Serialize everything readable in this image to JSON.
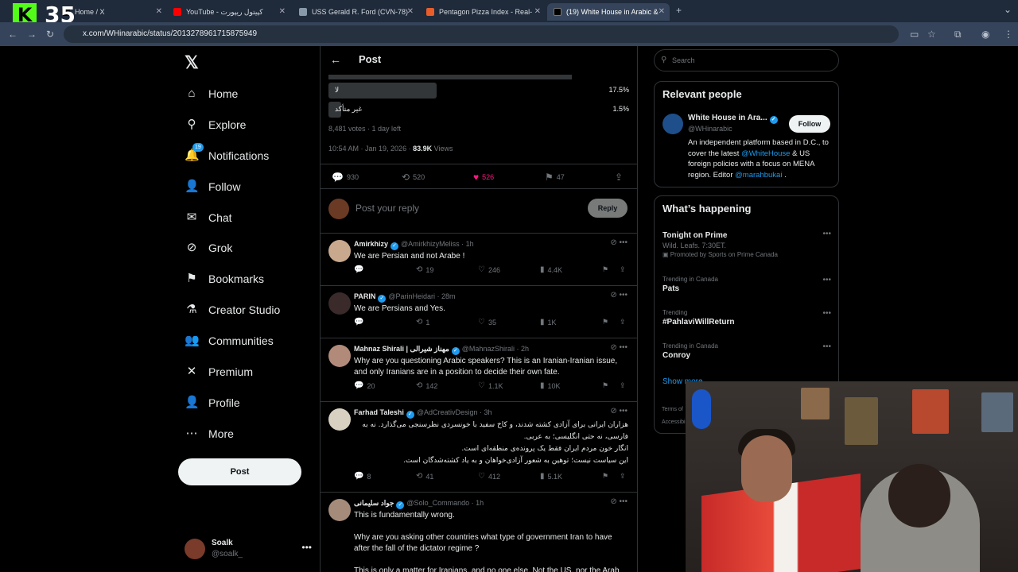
{
  "browser": {
    "tabs": [
      {
        "label": "Home / X",
        "fav": "#000000"
      },
      {
        "label": "YouTube - کپیتول ریپورت",
        "fav": "#ff0000"
      },
      {
        "label": "USS Gerald R. Ford (CVN-78)",
        "fav": "#8899aa"
      },
      {
        "label": "Pentagon Pizza Index - Real-",
        "fav": "#e85d2a"
      },
      {
        "label": "(19) White House in Arabic &",
        "fav": "#000000"
      }
    ],
    "url": "x.com/WHinarabic/status/2013278961715875949"
  },
  "stream": {
    "logo": "K",
    "count": "35"
  },
  "nav": {
    "items": [
      {
        "label": "Home",
        "icon": "home-icon",
        "glyph": "⌂"
      },
      {
        "label": "Explore",
        "icon": "search-icon",
        "glyph": "⚲"
      },
      {
        "label": "Notifications",
        "icon": "bell-icon",
        "glyph": "🔔"
      },
      {
        "label": "Follow",
        "icon": "person-add-icon",
        "glyph": "👤"
      },
      {
        "label": "Chat",
        "icon": "mail-icon",
        "glyph": "✉"
      },
      {
        "label": "Grok",
        "icon": "grok-icon",
        "glyph": "⊘"
      },
      {
        "label": "Bookmarks",
        "icon": "bookmark-icon",
        "glyph": "⚑"
      },
      {
        "label": "Creator Studio",
        "icon": "flask-icon",
        "glyph": "⚗"
      },
      {
        "label": "Communities",
        "icon": "people-icon",
        "glyph": "👥"
      },
      {
        "label": "Premium",
        "icon": "x-icon",
        "glyph": "✕"
      },
      {
        "label": "Profile",
        "icon": "profile-icon",
        "glyph": "👤"
      },
      {
        "label": "More",
        "icon": "more-circle-icon",
        "glyph": "⋯"
      }
    ],
    "notification_badge": "19",
    "post_button": "Post",
    "account": {
      "name": "Soalk",
      "handle": "@soalk_"
    }
  },
  "post": {
    "header": "Post",
    "poll": [
      {
        "label": "لا",
        "pct": "17.5%",
        "fraction": 0.175
      },
      {
        "label": "غير متأكد",
        "pct": "1.5%",
        "fraction": 0.015
      }
    ],
    "votes": "8,481 votes · 1 day left",
    "timestamp": "10:54 AM · Jan 19, 2026 · ",
    "views_count": "83.9K",
    "views_label": " Views",
    "stats": {
      "replies": "930",
      "reposts": "520",
      "likes": "526",
      "bookmarks": "47"
    },
    "reply_placeholder": "Post your reply",
    "reply_button": "Reply"
  },
  "replies": [
    {
      "name": "Amirkhizy",
      "handle": "@AmirkhizyMeliss · 1h",
      "text": "We are Persian and not Arabe !",
      "rtl": false,
      "reply": "",
      "repost": "19",
      "like": "246",
      "views": "4.4K",
      "avatar": "#c9a98e"
    },
    {
      "name": "PARIN",
      "handle": "@ParinHeidari · 28m",
      "text": "We are Persians and Yes.",
      "rtl": false,
      "reply": "",
      "repost": "1",
      "like": "35",
      "views": "1K",
      "avatar": "#3a2a2a"
    },
    {
      "name": "Mahnaz Shirali | مهناز شیرالی",
      "handle": "@MahnazShirali · 2h",
      "text": "Why are you questioning Arabic speakers? This is an Iranian-Iranian issue, and only Iranians are in a position to decide their own fate.",
      "rtl": false,
      "reply": "20",
      "repost": "142",
      "like": "1.1K",
      "views": "10K",
      "avatar": "#b28a7a"
    },
    {
      "name": "Farhad Taleshi",
      "handle": "@AdCreativDesign · 3h",
      "text": "هزاران ایرانی برای آزادی کشته شدند، و کاخ سفید با خونسردی نظرسنجی می‌گذارد. نه به فارسی، نه حتی انگلیسی؛ به عربی.\nانگار خون مردم ایران فقط یک پرونده‌ی منطقه‌ای است.\nاین سیاست نیست؛ توهین به شعور آزادی‌خواهان و به یاد کشته‌شدگان است.",
      "rtl": true,
      "reply": "8",
      "repost": "41",
      "like": "412",
      "views": "5.1K",
      "avatar": "#d8d0c0"
    },
    {
      "name": "جواد سلیمانی",
      "handle": "@Solo_Commando · 1h",
      "text": "This is fundamentally wrong.\n\nWhy are you asking other countries what type of government Iran to have after the fall of the dictator regime ?\n\nThis is only a matter for Iranians, and no one else. Not the US, nor the Arab",
      "rtl": false,
      "reply": "",
      "repost": "",
      "like": "",
      "views": "",
      "avatar": "#a58b7a"
    }
  ],
  "right": {
    "search_placeholder": "Search",
    "relevant_title": "Relevant people",
    "person": {
      "name": "White House in Ara...",
      "handle": "@WHinarabic",
      "follow": "Follow",
      "bio_1": "An independent platform based in D.C., to cover the latest ",
      "bio_link1": "@WhiteHouse",
      "bio_2": " & US foreign policies with a focus on MENA region. Editor ",
      "bio_link2": "@marahbukai",
      "bio_3": " ."
    },
    "happening_title": "What’s happening",
    "trends": [
      {
        "ctx": "",
        "title": "Tonight on Prime",
        "sub": "Wild. Leafs. 7:30ET.",
        "promo": "Promoted by Sports on Prime Canada"
      },
      {
        "ctx": "Trending in Canada",
        "title": "Pats",
        "sub": "",
        "promo": ""
      },
      {
        "ctx": "Trending",
        "title": "#PahlaviWillReturn",
        "sub": "",
        "promo": ""
      },
      {
        "ctx": "Trending in Canada",
        "title": "Conroy",
        "sub": "",
        "promo": ""
      }
    ],
    "show_more": "Show more",
    "footer": [
      "Terms of",
      "Accessibi"
    ]
  }
}
